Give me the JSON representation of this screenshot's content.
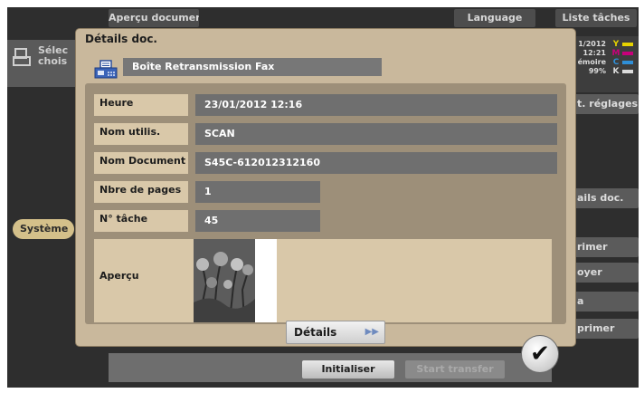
{
  "top_tabs": {
    "apercu_document": "Aperçu document",
    "language": "Language",
    "liste_taches": "Liste tâches"
  },
  "left_panel": {
    "text_line1": "Sélec",
    "text_line2": "chois"
  },
  "right_panel": {
    "line1": "1/2012",
    "line2": "12:21",
    "line3": "émoire",
    "line4": "99%",
    "toner_labels": [
      "Y",
      "M",
      "C",
      "K"
    ],
    "toner_colors": [
      "#e6d200",
      "#c8007a",
      "#2f8fd8",
      "#1a1a1a"
    ],
    "reglages": "t. réglages",
    "buttons": [
      "ails doc.",
      "rimer",
      "oyer",
      "a",
      "primer"
    ]
  },
  "systeme_button": "Système",
  "bottom": {
    "initialiser": "Initialiser",
    "disabled_btn": "Start transfer"
  },
  "dialog": {
    "title": "Détails doc.",
    "box_name": "Boîte Retransmission Fax",
    "rows": [
      {
        "label": "Heure",
        "value": "23/01/2012  12:16"
      },
      {
        "label": "Nom utilis.",
        "value": "SCAN"
      },
      {
        "label": "Nom Document",
        "value": "S45C-612012312160"
      },
      {
        "label": "Nbre de pages",
        "value": "1"
      },
      {
        "label": "N° tâche",
        "value": "45"
      }
    ],
    "preview_label": "Aperçu",
    "details_button": "Détails",
    "ok_symbol": "✔"
  }
}
